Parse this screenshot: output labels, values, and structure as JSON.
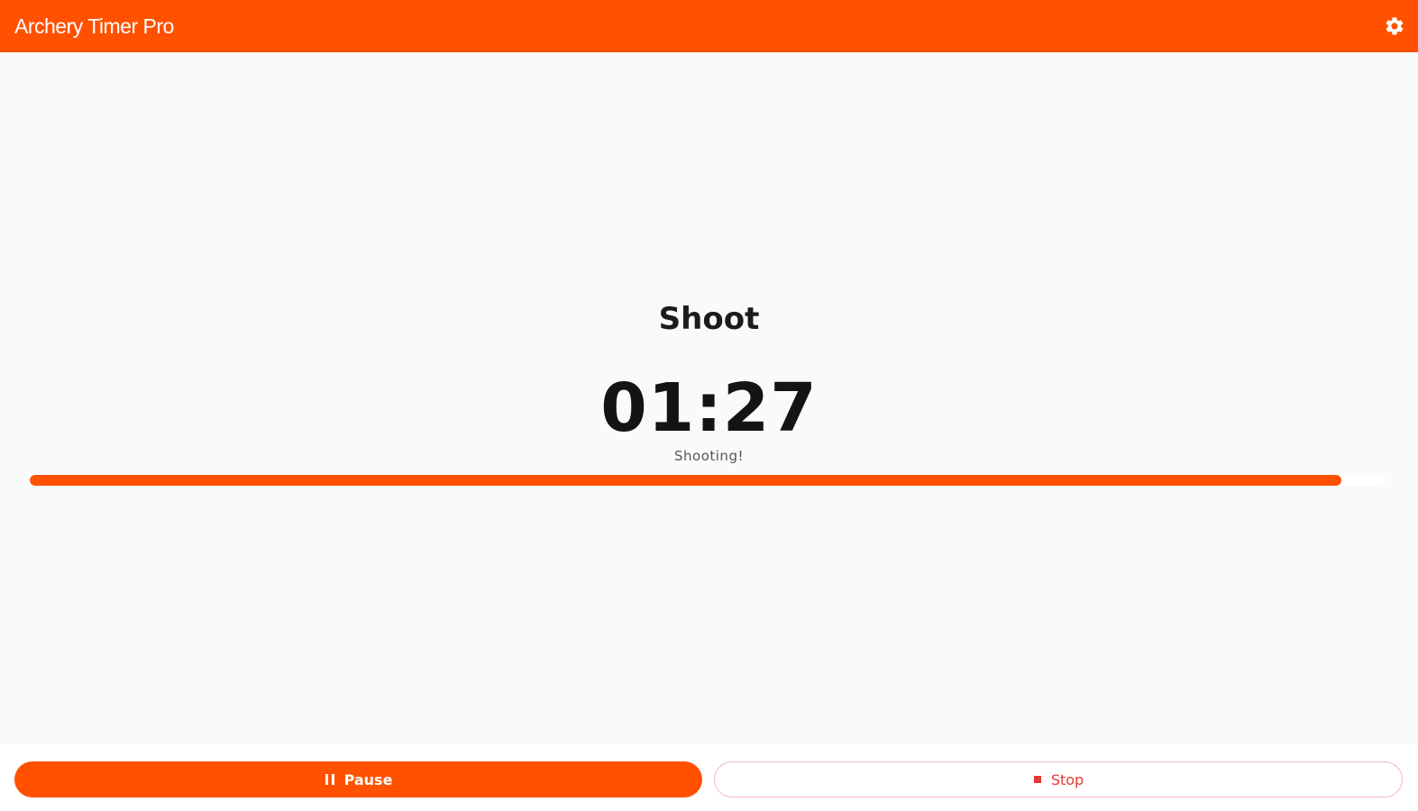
{
  "header": {
    "title": "Archery Timer Pro",
    "settings_icon": "gear-icon"
  },
  "timer": {
    "phase": "Shoot",
    "time": "01:27",
    "status": "Shooting!",
    "progress_fraction": 0.968
  },
  "controls": {
    "pause_label": "Pause",
    "pause_icon": "pause-icon",
    "stop_label": "Stop",
    "stop_icon": "stop-icon"
  },
  "colors": {
    "accent": "#ff5100",
    "stop": "#e53935",
    "background": "#fafafa"
  }
}
